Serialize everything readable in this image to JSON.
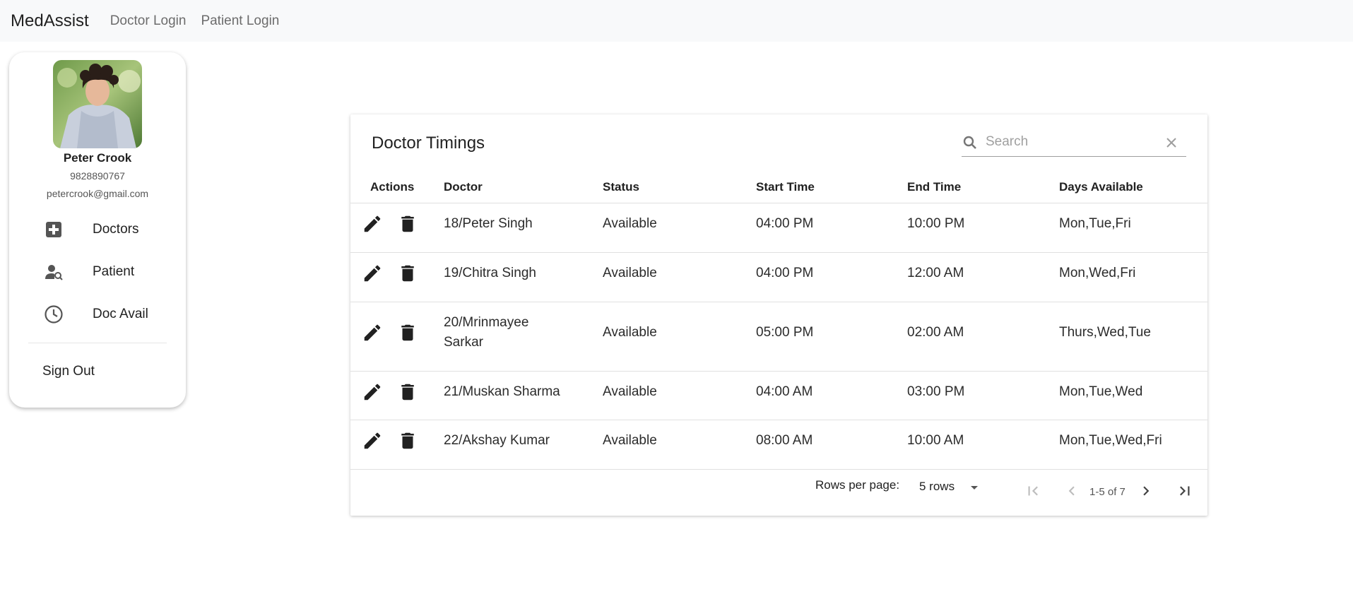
{
  "navbar": {
    "brand": "MedAssist",
    "links": [
      "Doctor Login",
      "Patient Login"
    ]
  },
  "profile": {
    "name": "Peter Crook",
    "phone": "9828890767",
    "email": "petercrook@gmail.com",
    "menu": [
      {
        "label": "Doctors",
        "icon": "medical-plus-icon"
      },
      {
        "label": "Patient",
        "icon": "person-search-icon"
      },
      {
        "label": "Doc Avail",
        "icon": "clock-icon"
      }
    ],
    "sign_out": "Sign Out"
  },
  "table": {
    "title": "Doctor Timings",
    "search_placeholder": "Search",
    "columns": [
      "Actions",
      "Doctor",
      "Status",
      "Start Time",
      "End Time",
      "Days Available"
    ],
    "rows": [
      {
        "doctor": "18/Peter Singh",
        "status": "Available",
        "start": "04:00 PM",
        "end": "10:00 PM",
        "days": "Mon,Tue,Fri"
      },
      {
        "doctor": "19/Chitra Singh",
        "status": "Available",
        "start": "04:00 PM",
        "end": "12:00 AM",
        "days": "Mon,Wed,Fri"
      },
      {
        "doctor": "20/Mrinmayee Sarkar",
        "status": "Available",
        "start": "05:00 PM",
        "end": "02:00 AM",
        "days": "Thurs,Wed,Tue"
      },
      {
        "doctor": "21/Muskan Sharma",
        "status": "Available",
        "start": "04:00 AM",
        "end": "03:00 PM",
        "days": "Mon,Tue,Wed"
      },
      {
        "doctor": "22/Akshay Kumar",
        "status": "Available",
        "start": "08:00 AM",
        "end": "10:00 AM",
        "days": "Mon,Tue,Wed,Fri"
      }
    ],
    "footer": {
      "rows_per_page_label": "Rows per page:",
      "rows_value": "5 rows",
      "range": "1-5 of 7"
    }
  }
}
